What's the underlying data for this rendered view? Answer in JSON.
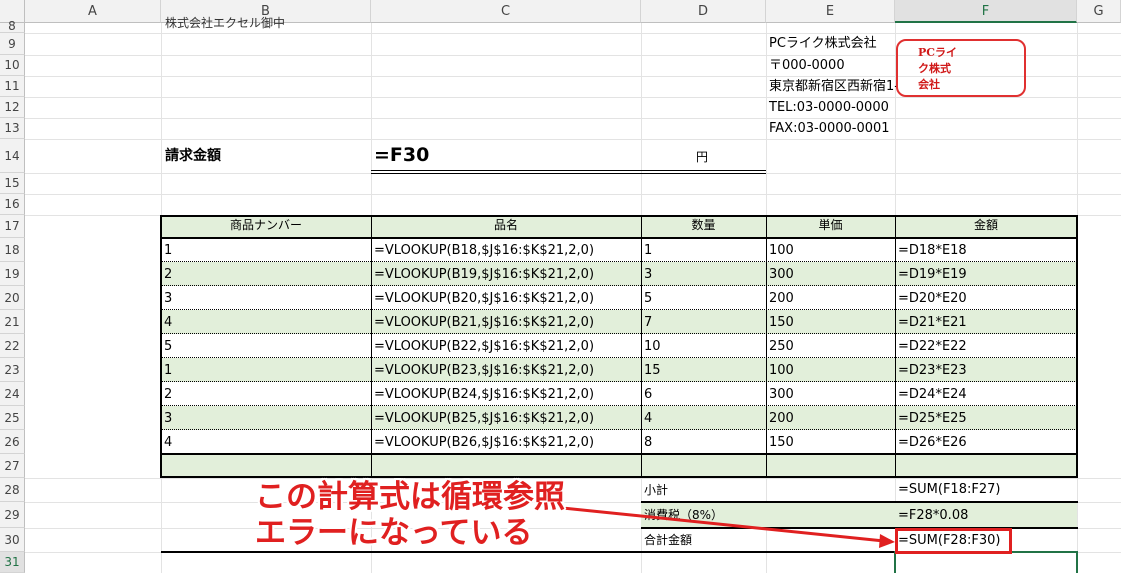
{
  "columns": [
    "A",
    "B",
    "C",
    "D",
    "E",
    "F",
    "G"
  ],
  "rows": [
    "8",
    "9",
    "10",
    "11",
    "12",
    "13",
    "14",
    "15",
    "16",
    "17",
    "18",
    "19",
    "20",
    "21",
    "22",
    "23",
    "24",
    "25",
    "26",
    "27",
    "28",
    "29",
    "30",
    "31"
  ],
  "partial_top_text": "株式会社エクセル御中",
  "company": {
    "name": "PCライク株式会社",
    "zip": "〒000-0000",
    "address": "東京都新宿区西新宿1-",
    "tel": "TEL:03-0000-0000",
    "fax": "FAX:03-0000-0001"
  },
  "stamp": {
    "line1": "PCライ",
    "line2": "ク株式",
    "line3": "会社"
  },
  "invoice": {
    "label": "請求金額",
    "formula": "=F30",
    "unit": "円"
  },
  "table": {
    "headers": [
      "商品ナンバー",
      "品名",
      "数量",
      "単価",
      "金額"
    ],
    "rows": [
      [
        "1",
        "=VLOOKUP(B18,$J$16:$K$21,2,0)",
        "1",
        "100",
        "=D18*E18"
      ],
      [
        "2",
        "=VLOOKUP(B19,$J$16:$K$21,2,0)",
        "3",
        "300",
        "=D19*E19"
      ],
      [
        "3",
        "=VLOOKUP(B20,$J$16:$K$21,2,0)",
        "5",
        "200",
        "=D20*E20"
      ],
      [
        "4",
        "=VLOOKUP(B21,$J$16:$K$21,2,0)",
        "7",
        "150",
        "=D21*E21"
      ],
      [
        "5",
        "=VLOOKUP(B22,$J$16:$K$21,2,0)",
        "10",
        "250",
        "=D22*E22"
      ],
      [
        "1",
        "=VLOOKUP(B23,$J$16:$K$21,2,0)",
        "15",
        "100",
        "=D23*E23"
      ],
      [
        "2",
        "=VLOOKUP(B24,$J$16:$K$21,2,0)",
        "6",
        "300",
        "=D24*E24"
      ],
      [
        "3",
        "=VLOOKUP(B25,$J$16:$K$21,2,0)",
        "4",
        "200",
        "=D25*E25"
      ],
      [
        "4",
        "=VLOOKUP(B26,$J$16:$K$21,2,0)",
        "8",
        "150",
        "=D26*E26"
      ]
    ]
  },
  "totals": [
    {
      "label": "小計",
      "formula": "=SUM(F18:F27)"
    },
    {
      "label": "消費税（8%）",
      "formula": "=F28*0.08"
    },
    {
      "label": "合計金額",
      "formula": "=SUM(F28:F30)"
    }
  ],
  "callout": {
    "line1": "この計算式は循環参照",
    "line2": "エラーになっている"
  },
  "colors": {
    "accent_green": "#e2efda",
    "annotation_red": "#e02020",
    "selection_green": "#217346"
  }
}
